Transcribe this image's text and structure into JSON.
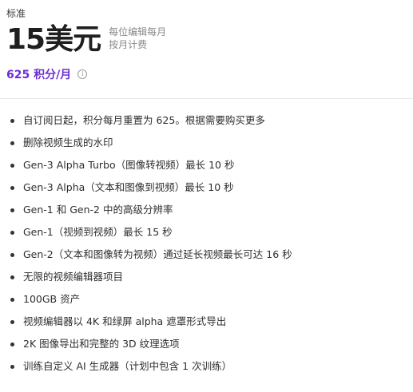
{
  "plan": {
    "name": "标准",
    "price": "15美元",
    "price_note_line1": "每位编辑每月",
    "price_note_line2": "按月计费",
    "credits": "625 积分/月",
    "info_icon": "info-icon"
  },
  "features": [
    "自订阅日起，积分每月重置为 625。根据需要购买更多",
    "删除视频生成的水印",
    "Gen-3 Alpha Turbo（图像转视频）最长 10 秒",
    "Gen-3 Alpha（文本和图像到视频）最长 10 秒",
    "Gen-1 和 Gen-2 中的高级分辨率",
    "Gen-1（视频到视频）最长 15 秒",
    "Gen-2（文本和图像转为视频）通过延长视频最长可达 16 秒",
    "无限的视频编辑器项目",
    "100GB 资产",
    "视频编辑器以 4K 和绿屏 alpha 遮罩形式导出",
    "2K 图像导出和完整的 3D 纹理选项",
    "训练自定义 AI 生成器（计划中包含 1 次训练）"
  ]
}
